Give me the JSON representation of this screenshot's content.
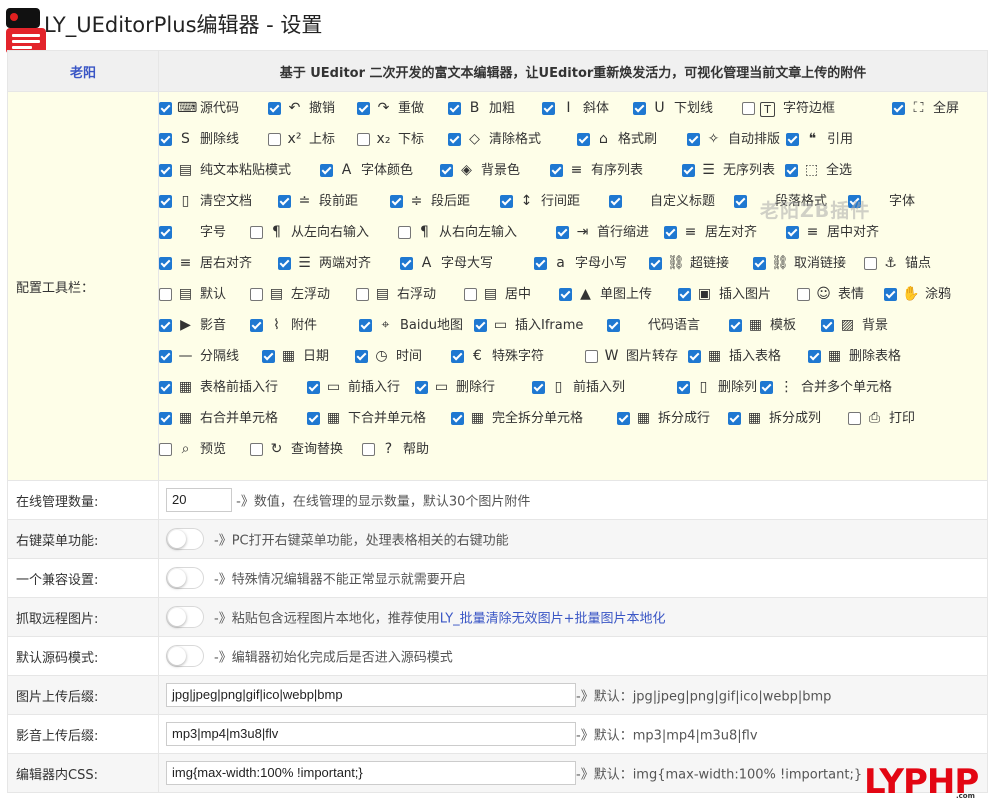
{
  "page": {
    "title": "LY_UEditorPlus编辑器 - 设置",
    "author": "老阳",
    "description": "基于 UEditor 二次开发的富文本编辑器，让UEditor重新焕发活力，可视化管理当前文章上传的附件"
  },
  "toolbar_section": {
    "label": "配置工具栏：",
    "rows": [
      [
        {
          "label": "源代码",
          "checked": true,
          "icon": "html-icon"
        },
        {
          "label": "撤销",
          "checked": true,
          "icon": "undo-icon"
        },
        {
          "label": "重做",
          "checked": true,
          "icon": "redo-icon"
        },
        {
          "label": "加粗",
          "checked": true,
          "icon": "bold-icon"
        },
        {
          "label": "斜体",
          "checked": true,
          "icon": "italic-icon"
        },
        {
          "label": "下划线",
          "checked": true,
          "icon": "underline-icon"
        },
        {
          "label": "字符边框",
          "checked": false,
          "icon": "text-border-icon"
        },
        {
          "label": "全屏",
          "checked": true,
          "icon": "fullscreen-icon"
        }
      ],
      [
        {
          "label": "删除线",
          "checked": true,
          "icon": "strikethrough-icon"
        },
        {
          "label": "上标",
          "checked": false,
          "icon": "superscript-icon"
        },
        {
          "label": "下标",
          "checked": false,
          "icon": "subscript-icon"
        },
        {
          "label": "清除格式",
          "checked": true,
          "icon": "eraser-icon"
        },
        {
          "label": "格式刷",
          "checked": true,
          "icon": "format-brush-icon"
        },
        {
          "label": "自动排版",
          "checked": true,
          "icon": "magic-wand-icon"
        },
        {
          "label": "引用",
          "checked": true,
          "icon": "quote-icon"
        }
      ],
      [
        {
          "label": "纯文本粘贴模式",
          "checked": true,
          "icon": "paste-icon"
        },
        {
          "label": "字体颜色",
          "checked": true,
          "icon": "font-color-icon"
        },
        {
          "label": "背景色",
          "checked": true,
          "icon": "paint-bucket-icon"
        },
        {
          "label": "有序列表",
          "checked": true,
          "icon": "ordered-list-icon"
        },
        {
          "label": "无序列表",
          "checked": true,
          "icon": "unordered-list-icon"
        },
        {
          "label": "全选",
          "checked": true,
          "icon": "select-all-icon"
        }
      ],
      [
        {
          "label": "清空文档",
          "checked": true,
          "icon": "document-icon"
        },
        {
          "label": "段前距",
          "checked": true,
          "icon": "space-before-icon"
        },
        {
          "label": "段后距",
          "checked": true,
          "icon": "space-after-icon"
        },
        {
          "label": "行间距",
          "checked": true,
          "icon": "line-height-icon"
        },
        {
          "label": "自定义标题",
          "checked": true,
          "icon": "none"
        },
        {
          "label": "段落格式",
          "checked": true,
          "icon": "none"
        },
        {
          "label": "字体",
          "checked": true,
          "icon": "none"
        }
      ],
      [
        {
          "label": "字号",
          "checked": true,
          "icon": "none"
        },
        {
          "label": "从左向右输入",
          "checked": false,
          "icon": "ltr-icon"
        },
        {
          "label": "从右向左输入",
          "checked": false,
          "icon": "rtl-icon"
        },
        {
          "label": "首行缩进",
          "checked": true,
          "icon": "indent-icon"
        },
        {
          "label": "居左对齐",
          "checked": true,
          "icon": "align-left-icon"
        },
        {
          "label": "居中对齐",
          "checked": true,
          "icon": "align-center-icon"
        }
      ],
      [
        {
          "label": "居右对齐",
          "checked": true,
          "icon": "align-right-icon"
        },
        {
          "label": "两端对齐",
          "checked": true,
          "icon": "align-justify-icon"
        },
        {
          "label": "字母大写",
          "checked": true,
          "icon": "uppercase-icon"
        },
        {
          "label": "字母小写",
          "checked": true,
          "icon": "lowercase-icon"
        },
        {
          "label": "超链接",
          "checked": true,
          "icon": "link-icon"
        },
        {
          "label": "取消链接",
          "checked": true,
          "icon": "unlink-icon"
        },
        {
          "label": "锚点",
          "checked": false,
          "icon": "anchor-icon"
        }
      ],
      [
        {
          "label": "默认",
          "checked": false,
          "icon": "image-none-icon"
        },
        {
          "label": "左浮动",
          "checked": false,
          "icon": "float-left-icon"
        },
        {
          "label": "右浮动",
          "checked": false,
          "icon": "float-right-icon"
        },
        {
          "label": "居中",
          "checked": false,
          "icon": "image-center-icon"
        },
        {
          "label": "单图上传",
          "checked": true,
          "icon": "image-upload-icon"
        },
        {
          "label": "插入图片",
          "checked": true,
          "icon": "image-icon"
        },
        {
          "label": "表情",
          "checked": false,
          "icon": "smile-icon"
        },
        {
          "label": "涂鸦",
          "checked": true,
          "icon": "scrawl-icon"
        }
      ],
      [
        {
          "label": "影音",
          "checked": true,
          "icon": "play-icon"
        },
        {
          "label": "附件",
          "checked": true,
          "icon": "paperclip-icon"
        },
        {
          "label": "Baidu地图",
          "checked": true,
          "icon": "map-icon"
        },
        {
          "label": "插入Iframe",
          "checked": true,
          "icon": "iframe-icon"
        },
        {
          "label": "代码语言",
          "checked": true,
          "icon": "none"
        },
        {
          "label": "模板",
          "checked": true,
          "icon": "template-icon"
        },
        {
          "label": "背景",
          "checked": true,
          "icon": "background-icon"
        }
      ],
      [
        {
          "label": "分隔线",
          "checked": true,
          "icon": "horizontal-rule-icon"
        },
        {
          "label": "日期",
          "checked": true,
          "icon": "calendar-icon"
        },
        {
          "label": "时间",
          "checked": true,
          "icon": "clock-icon"
        },
        {
          "label": "特殊字符",
          "checked": true,
          "icon": "euro-icon"
        },
        {
          "label": "图片转存",
          "checked": false,
          "icon": "word-image-icon"
        },
        {
          "label": "插入表格",
          "checked": true,
          "icon": "table-icon"
        },
        {
          "label": "删除表格",
          "checked": true,
          "icon": "delete-table-icon"
        }
      ],
      [
        {
          "label": "表格前插入行",
          "checked": true,
          "icon": "insert-para-icon"
        },
        {
          "label": "前插入行",
          "checked": true,
          "icon": "insert-row-icon"
        },
        {
          "label": "删除行",
          "checked": true,
          "icon": "delete-row-icon"
        },
        {
          "label": "前插入列",
          "checked": true,
          "icon": "insert-col-icon"
        },
        {
          "label": "删除列",
          "checked": true,
          "icon": "delete-col-icon"
        },
        {
          "label": "合并多个单元格",
          "checked": true,
          "icon": "merge-cells-icon"
        }
      ],
      [
        {
          "label": "右合并单元格",
          "checked": true,
          "icon": "merge-right-icon"
        },
        {
          "label": "下合并单元格",
          "checked": true,
          "icon": "merge-down-icon"
        },
        {
          "label": "完全拆分单元格",
          "checked": true,
          "icon": "split-cells-icon"
        },
        {
          "label": "拆分成行",
          "checked": true,
          "icon": "split-rows-icon"
        },
        {
          "label": "拆分成列",
          "checked": true,
          "icon": "split-cols-icon"
        },
        {
          "label": "打印",
          "checked": false,
          "icon": "print-icon"
        }
      ],
      [
        {
          "label": "预览",
          "checked": false,
          "icon": "preview-icon"
        },
        {
          "label": "查询替换",
          "checked": false,
          "icon": "search-replace-icon"
        },
        {
          "label": "帮助",
          "checked": false,
          "icon": "help-icon"
        }
      ]
    ]
  },
  "settings": {
    "online_count": {
      "label": "在线管理数量:",
      "value": "20",
      "note": "-》数值，在线管理的显示数量，默认30个图片附件"
    },
    "context_menu": {
      "label": "右键菜单功能:",
      "note": "-》PC打开右键菜单功能，处理表格相关的右键功能",
      "enabled": false
    },
    "compat": {
      "label": "一个兼容设置:",
      "note": "-》特殊情况编辑器不能正常显示就需要开启",
      "enabled": false
    },
    "remote_image": {
      "label": "抓取远程图片:",
      "note": "-》粘贴包含远程图片本地化，推荐使用",
      "link": "LY_批量清除无效图片+批量图片本地化",
      "enabled": false
    },
    "source_mode": {
      "label": "默认源码模式:",
      "note": "-》编辑器初始化完成后是否进入源码模式",
      "enabled": false
    },
    "image_ext": {
      "label": "图片上传后缀:",
      "value": "jpg|jpeg|png|gif|ico|webp|bmp",
      "note": "-》默认：jpg|jpeg|png|gif|ico|webp|bmp"
    },
    "media_ext": {
      "label": "影音上传后缀:",
      "value": "mp3|mp4|m3u8|flv",
      "note": "-》默认：mp3|mp4|m3u8|flv"
    },
    "editor_css": {
      "label": "编辑器内CSS:",
      "value": "img{max-width:100% !important;}",
      "note": "-》默认：img{max-width:100% !important;}"
    }
  },
  "watermarks": {
    "zblog": "老阳ZB插件",
    "lyphp": "LYPHP",
    "lyphp_sub": ".com"
  },
  "colors": {
    "checkbox": "#1f78d1",
    "toolbar_bg": "#fefee8",
    "link": "#3a56c5",
    "brand_red": "#e3242b"
  }
}
